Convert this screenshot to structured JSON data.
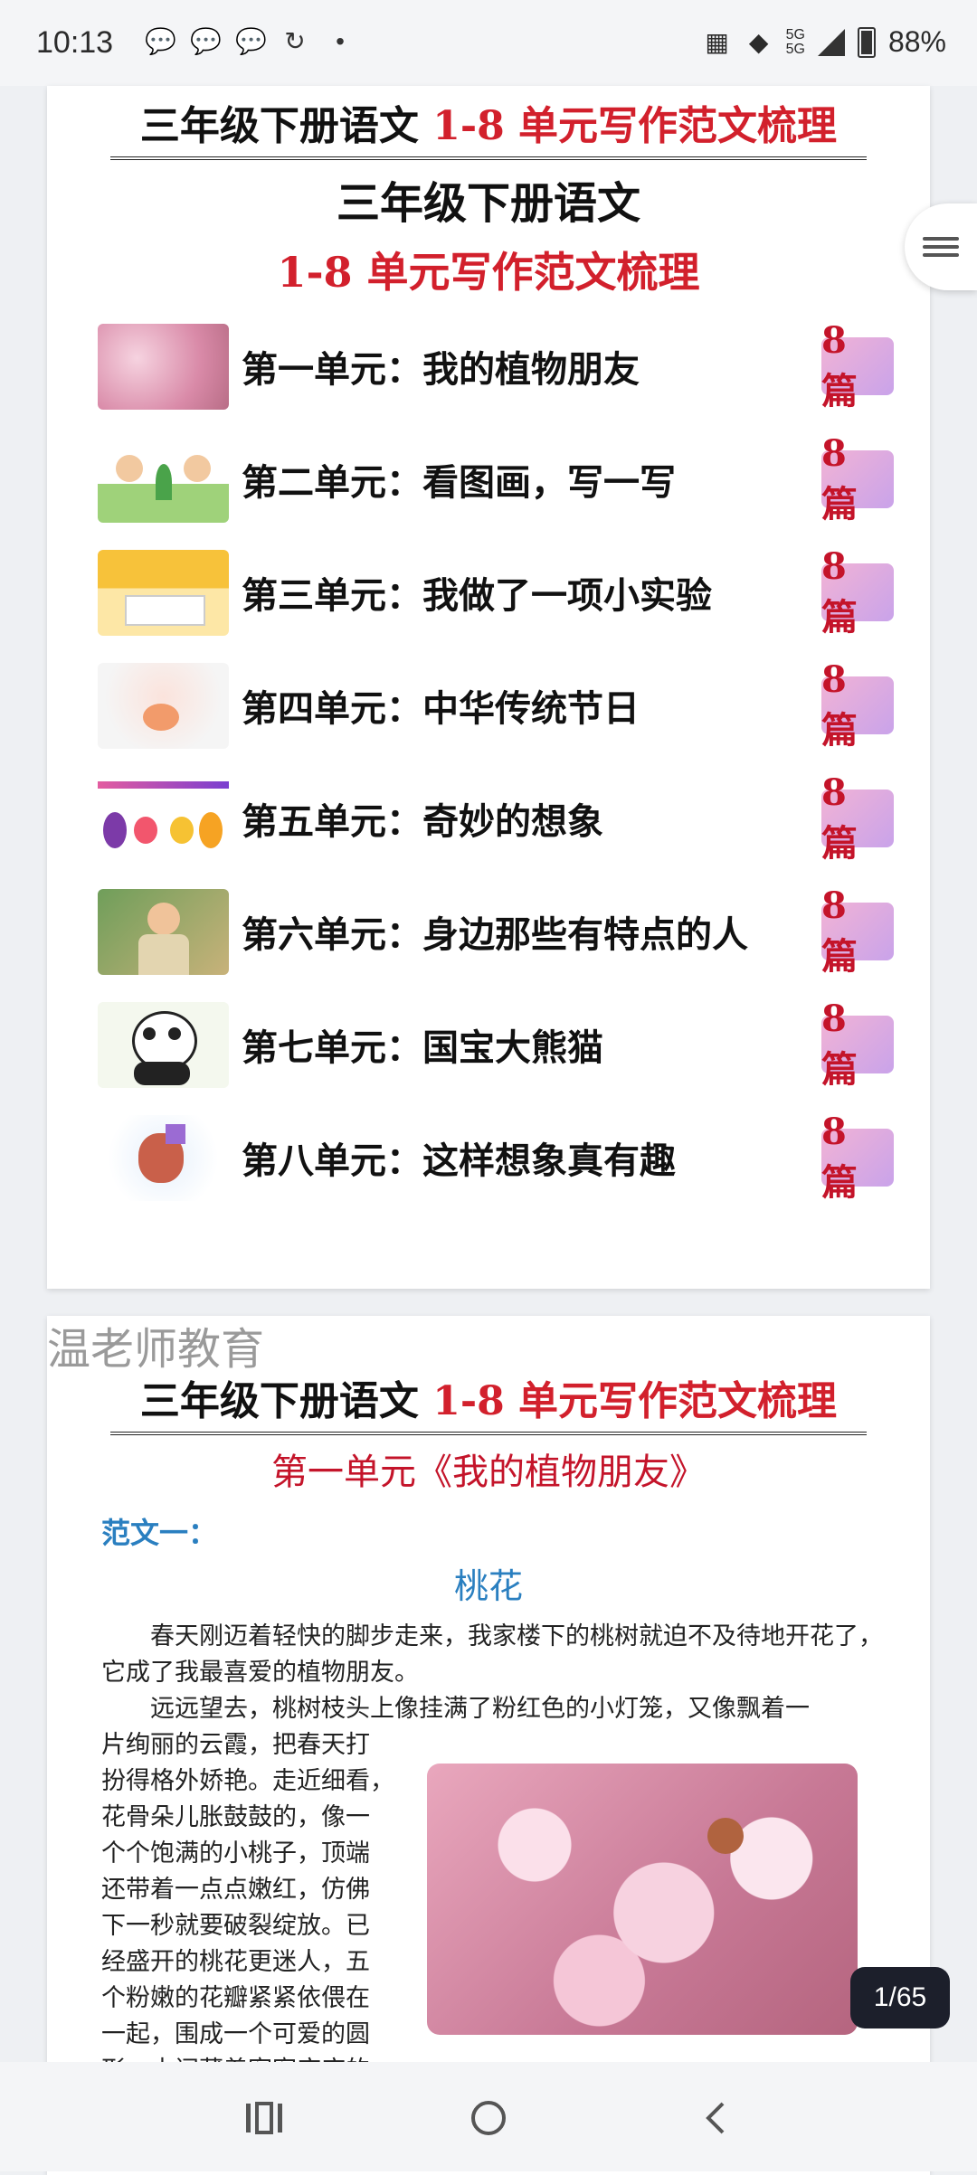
{
  "status_bar": {
    "time": "10:13",
    "battery": "88%",
    "network": "5G"
  },
  "card1": {
    "headline_black": "三年级下册语文",
    "headline_red": "1-8 单元写作范文梳理",
    "subtitle_1": "三年级下册语文",
    "subtitle_2": "1-8 单元写作范文梳理",
    "units": [
      {
        "label": "第一单元：我的植物朋友",
        "count": "8 篇"
      },
      {
        "label": "第二单元：看图画，写一写",
        "count": "8 篇"
      },
      {
        "label": "第三单元：我做了一项小实验",
        "count": "8 篇"
      },
      {
        "label": "第四单元：中华传统节日",
        "count": "8 篇"
      },
      {
        "label": "第五单元：奇妙的想象",
        "count": "8 篇"
      },
      {
        "label": "第六单元：身边那些有特点的人",
        "count": "8 篇"
      },
      {
        "label": "第七单元：国宝大熊猫",
        "count": "8 篇"
      },
      {
        "label": "第八单元：这样想象真有趣",
        "count": "8 篇"
      }
    ]
  },
  "card2": {
    "watermark": "温老师教育",
    "headline_black": "三年级下册语文",
    "headline_red": "1-8 单元写作范文梳理",
    "unit_title": "第一单元《我的植物朋友》",
    "sample_label": "范文一：",
    "essay_title": "桃花",
    "para1": "春天刚迈着轻快的脚步走来，我家楼下的桃树就迫不及待地开花了，它成了我最喜爱的植物朋友。",
    "para2": "远远望去，桃树枝头上像挂满了粉红色的小灯笼，又像飘着一",
    "narrow_lines": [
      "片绚丽的云霞，把春天打",
      "扮得格外娇艳。走近细看，",
      "花骨朵儿胀鼓鼓的，像一",
      "个个饱满的小桃子，顶端",
      "还带着一点点嫩红，仿佛",
      "下一秒就要破裂绽放。已",
      "经盛开的桃花更迷人，五",
      "个粉嫩的花瓣紧紧依偎在",
      "一起，围成一个可爱的圆",
      "形，中间藏着密密麻麻的"
    ]
  },
  "page_indicator": "1/65",
  "colors": {
    "accent_red": "#d2202c",
    "accent_blue": "#2a7fc0",
    "badge_gradient": [
      "#f2b3d5",
      "#c9a3ea"
    ]
  },
  "icons": [
    "wechat-icon",
    "sync-icon",
    "signal-icon",
    "battery-icon",
    "menu-icon",
    "recents-icon",
    "home-icon",
    "back-icon"
  ]
}
